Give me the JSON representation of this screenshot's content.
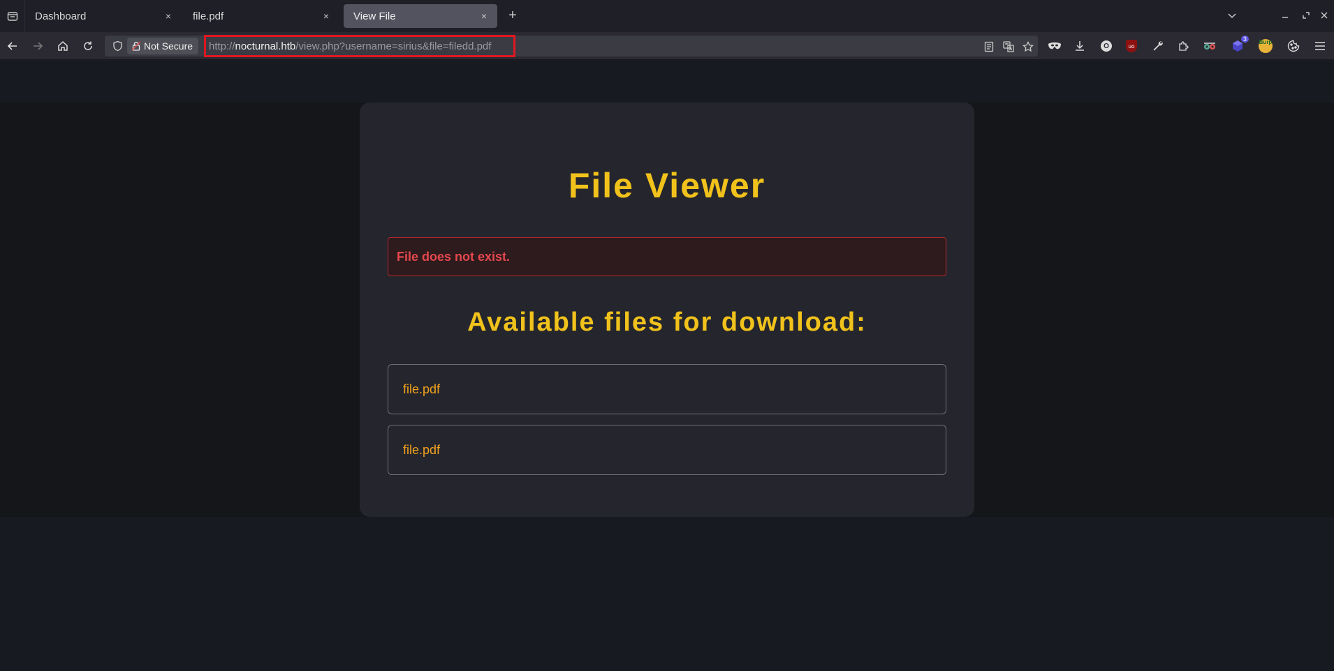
{
  "browser": {
    "tabs": [
      {
        "title": "Dashboard",
        "active": false
      },
      {
        "title": "file.pdf",
        "active": false
      },
      {
        "title": "View File",
        "active": true
      }
    ],
    "close_glyph": "×",
    "new_tab_glyph": "+",
    "security_label": "Not Secure",
    "url": {
      "scheme": "http://",
      "host": "nocturnal.htb",
      "path": "/view.php?username=sirius&file=filedd.pdf"
    },
    "extension_badge_count": "3",
    "burp_label": "Burp"
  },
  "page": {
    "title": "File Viewer",
    "error_message": "File does not exist.",
    "files_heading": "Available files for download:",
    "files": [
      {
        "name": "file.pdf"
      },
      {
        "name": "file.pdf"
      }
    ]
  },
  "colors": {
    "accent": "#f1c21b",
    "link": "#f0a01e",
    "error": "#e5484d",
    "highlight": "#e0171f"
  }
}
